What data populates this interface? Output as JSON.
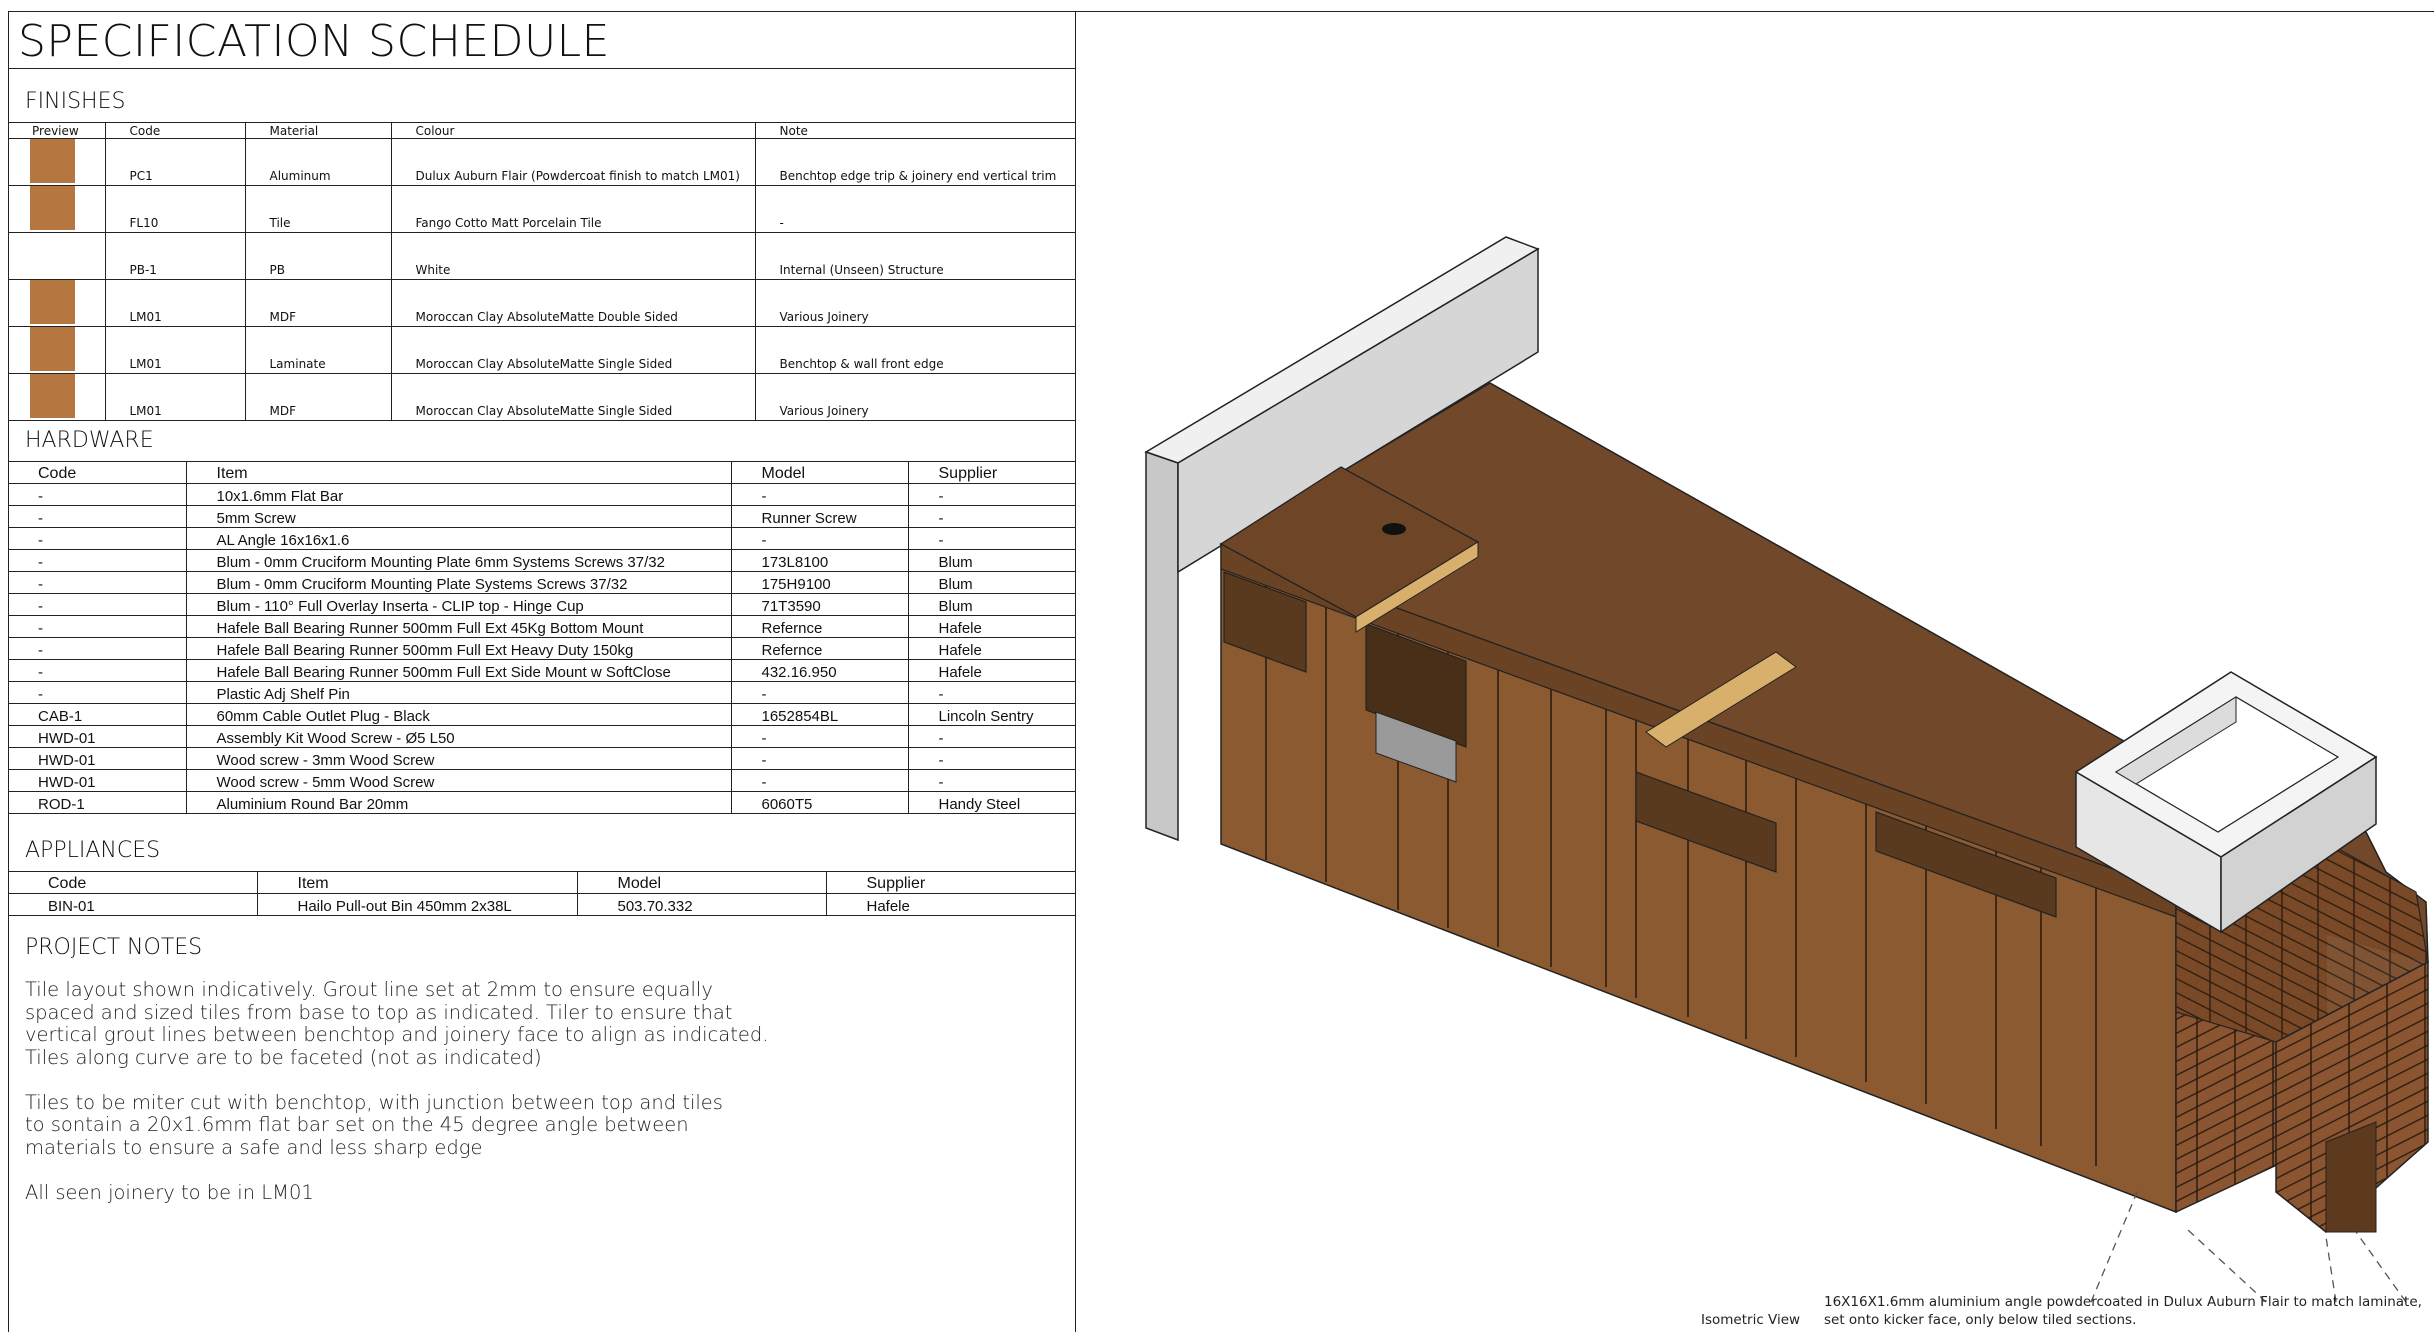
{
  "title": "SPECIFICATION SCHEDULE",
  "finishes": {
    "heading": "FINISHES",
    "columns": [
      "Preview",
      "Code",
      "Material",
      "Colour",
      "Note"
    ],
    "rows": [
      {
        "swatch": "#b5763f",
        "code": "PC1",
        "material": "Aluminum",
        "colour": "Dulux Auburn Flair (Powdercoat finish to match LM01)",
        "note": "Benchtop edge trip & joinery end vertical trim"
      },
      {
        "swatch": "#b5763f",
        "code": "FL10",
        "material": "Tile",
        "colour": "Fango Cotto Matt Porcelain Tile",
        "note": "-"
      },
      {
        "swatch": "#ffffff",
        "code": "PB-1",
        "material": "PB",
        "colour": "White",
        "note": "Internal (Unseen) Structure"
      },
      {
        "swatch": "#b5763f",
        "code": "LM01",
        "material": "MDF",
        "colour": "Moroccan Clay AbsoluteMatte Double Sided",
        "note": "Various Joinery"
      },
      {
        "swatch": "#b5763f",
        "code": "LM01",
        "material": "Laminate",
        "colour": "Moroccan Clay AbsoluteMatte Single Sided",
        "note": "Benchtop & wall front edge"
      },
      {
        "swatch": "#b5763f",
        "code": "LM01",
        "material": "MDF",
        "colour": "Moroccan Clay AbsoluteMatte Single Sided",
        "note": "Various Joinery"
      }
    ]
  },
  "hardware": {
    "heading": "HARDWARE",
    "columns": [
      "Code",
      "Item",
      "Model",
      "Supplier"
    ],
    "rows": [
      [
        "-",
        "10x1.6mm Flat Bar",
        "-",
        "-"
      ],
      [
        "-",
        "5mm Screw",
        "Runner Screw",
        "-"
      ],
      [
        "-",
        "AL Angle 16x16x1.6",
        "-",
        "-"
      ],
      [
        "-",
        "Blum - 0mm Cruciform Mounting Plate 6mm Systems Screws 37/32",
        "173L8100",
        "Blum"
      ],
      [
        "-",
        "Blum - 0mm Cruciform Mounting Plate Systems Screws 37/32",
        "175H9100",
        "Blum"
      ],
      [
        "-",
        "Blum - 110° Full Overlay Inserta - CLIP top - Hinge Cup",
        "71T3590",
        "Blum"
      ],
      [
        "-",
        "Hafele Ball Bearing Runner 500mm Full Ext 45Kg Bottom Mount",
        "Refernce",
        "Hafele"
      ],
      [
        "-",
        "Hafele Ball Bearing Runner 500mm Full Ext Heavy Duty 150kg",
        "Refernce",
        "Hafele"
      ],
      [
        "-",
        "Hafele Ball Bearing Runner 500mm Full Ext Side Mount w SoftClose",
        "432.16.950",
        "Hafele"
      ],
      [
        "-",
        "Plastic Adj Shelf Pin",
        "-",
        "-"
      ],
      [
        "CAB-1",
        "60mm Cable Outlet Plug - Black",
        "1652854BL",
        "Lincoln Sentry"
      ],
      [
        "HWD-01",
        "Assembly Kit Wood Screw - Ø5 L50",
        "-",
        "-"
      ],
      [
        "HWD-01",
        "Wood screw - 3mm Wood Screw",
        "-",
        "-"
      ],
      [
        "HWD-01",
        "Wood screw - 5mm Wood Screw",
        "-",
        "-"
      ],
      [
        "ROD-1",
        "Aluminium Round Bar 20mm",
        "6060T5",
        "Handy Steel"
      ]
    ]
  },
  "appliances": {
    "heading": "APPLIANCES",
    "columns": [
      "Code",
      "Item",
      "Model",
      "Supplier"
    ],
    "rows": [
      [
        "BIN-01",
        "Hailo Pull-out Bin 450mm 2x38L",
        "503.70.332",
        "Hafele"
      ]
    ]
  },
  "project_notes": {
    "heading": "PROJECT NOTES",
    "lines": [
      "Tile layout shown indicatively. Grout line set at 2mm to ensure equally",
      "spaced and sized tiles from base to top as indicated. Tiler to ensure that",
      "vertical grout lines between benchtop and joinery face to align as indicated.",
      "Tiles along curve are to be faceted (not as indicated)",
      "",
      "Tiles to be miter cut with benchtop, with junction between top and tiles",
      "to sontain a 20x1.6mm flat bar set on the 45 degree angle between",
      "materials to ensure a safe and less sharp edge",
      "",
      "All seen joinery to be in LM01"
    ]
  },
  "drawing": {
    "view_label": "Isometric View",
    "annotation_line1": "16X16X1.6mm aluminium angle powdercoated in Dulux Auburn Flair to match laminate,",
    "annotation_line2": "set onto kicker face, only below tiled sections.",
    "colors": {
      "laminate": "#8b5a30",
      "laminate_top": "#72482a",
      "tile": "#8a5530",
      "wall": "#d8d8d8",
      "basin": "#e4e4e4"
    }
  }
}
